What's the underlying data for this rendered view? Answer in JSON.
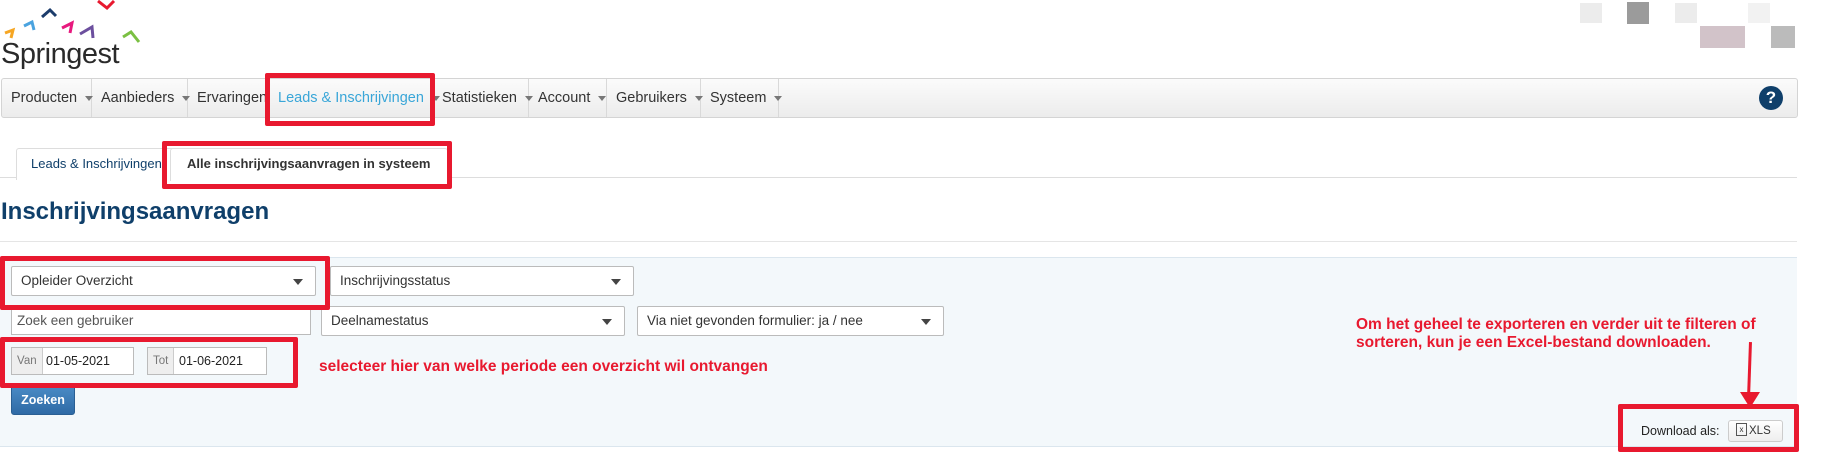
{
  "brand": {
    "name": "Springest"
  },
  "nav": {
    "items": [
      {
        "label": "Producten",
        "caret": true
      },
      {
        "label": "Aanbieders",
        "caret": true
      },
      {
        "label": "Ervaringen",
        "caret": false
      },
      {
        "label": "Leads & Inschrijvingen",
        "caret": true,
        "active": true
      },
      {
        "label": "Statistieken",
        "caret": true
      },
      {
        "label": "Account",
        "caret": true
      },
      {
        "label": "Gebruikers",
        "caret": true
      },
      {
        "label": "Systeem",
        "caret": true
      }
    ],
    "help_icon": "question-circle-icon"
  },
  "tabs": [
    {
      "label": "Leads & Inschrijvingen",
      "active": false
    },
    {
      "label": "Alle inschrijvingsaanvragen in systeem",
      "active": true
    }
  ],
  "page": {
    "title": "Inschrijvingsaanvragen"
  },
  "filters": {
    "view_select": "Opleider Overzicht",
    "status_select": "Inschrijvingsstatus",
    "user_search_placeholder": "Zoek een gebruiker",
    "participation_select": "Deelnamestatus",
    "form_select": "Via niet gevonden formulier: ja / nee",
    "date_from_prefix": "Van",
    "date_from": "01-05-2021",
    "date_to_prefix": "Tot",
    "date_to": "01-06-2021",
    "search_button": "Zoeken"
  },
  "download": {
    "label": "Download als:",
    "xls_button": "XLS",
    "xls_icon": "excel-file-icon"
  },
  "annotations": {
    "period_note": "selecteer hier van welke periode een overzicht wil ontvangen",
    "export_note_line1": "Om het geheel te exporteren en verder uit te filteren of",
    "export_note_line2": "sorteren, kun je een Excel-bestand downloaden.",
    "highlight_color": "#e8192f"
  },
  "colors": {
    "brand_blue": "#0f3f6a",
    "active_link": "#39a6d8",
    "button_blue": "#2f6aa5"
  }
}
